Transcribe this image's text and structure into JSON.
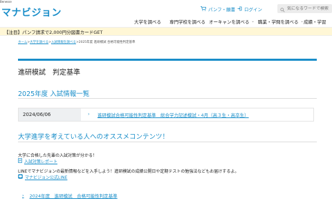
{
  "brand": {
    "corp": "Benesse",
    "logo": "マナビジョン"
  },
  "header": {
    "pamphlet": "パンフ・願書",
    "login": "ログイン",
    "search_placeholder": "気になるワードで検索"
  },
  "nav": {
    "items": [
      {
        "label": "大学を調べる",
        "dropdown": false
      },
      {
        "label": "専門学校を調べる",
        "dropdown": false
      },
      {
        "label": "オーキャンを調べる",
        "dropdown": true
      },
      {
        "label": "職業・学問を調べる",
        "dropdown": true
      },
      {
        "label": "成績・学習",
        "dropdown": false
      }
    ]
  },
  "banner": {
    "text": "【注目】パンフ請求で2,000円分図書カードGET"
  },
  "breadcrumb": {
    "items": [
      "ホーム",
      "大学を調べる",
      "入試情報を調べる"
    ],
    "current": "2025年度 進研模試 合格可能性判定基準",
    "separator": ">"
  },
  "page": {
    "title": "進研模試　判定基準",
    "section1_title": "2025年度 入試情報一覧",
    "row": {
      "date": "2024/06/06",
      "link": "進研模試合格可能性判定基準　総合学力記述模試・4月（高３生・高卒生）"
    },
    "section2_title": "大学進学を考えている人へのオススメコンテンツ！",
    "promo1_text": "大学に合格した先輩の入試対策が分かる！",
    "promo1_link": "入試対策レポート",
    "promo2_text": "LINEでマナビジョンの最新情報などを入手しよう！進研模試の成績公開日や定期テストの勉強法などもお届けするよ。",
    "promo2_link": "マナビジョン公式LINE",
    "bottom_link": "2024年度　進研模試　合格可能性判定基準"
  },
  "colors": {
    "accent": "#1a8ec9",
    "banner_bg": "#fff7d6",
    "date_bg": "#eef0f2"
  }
}
